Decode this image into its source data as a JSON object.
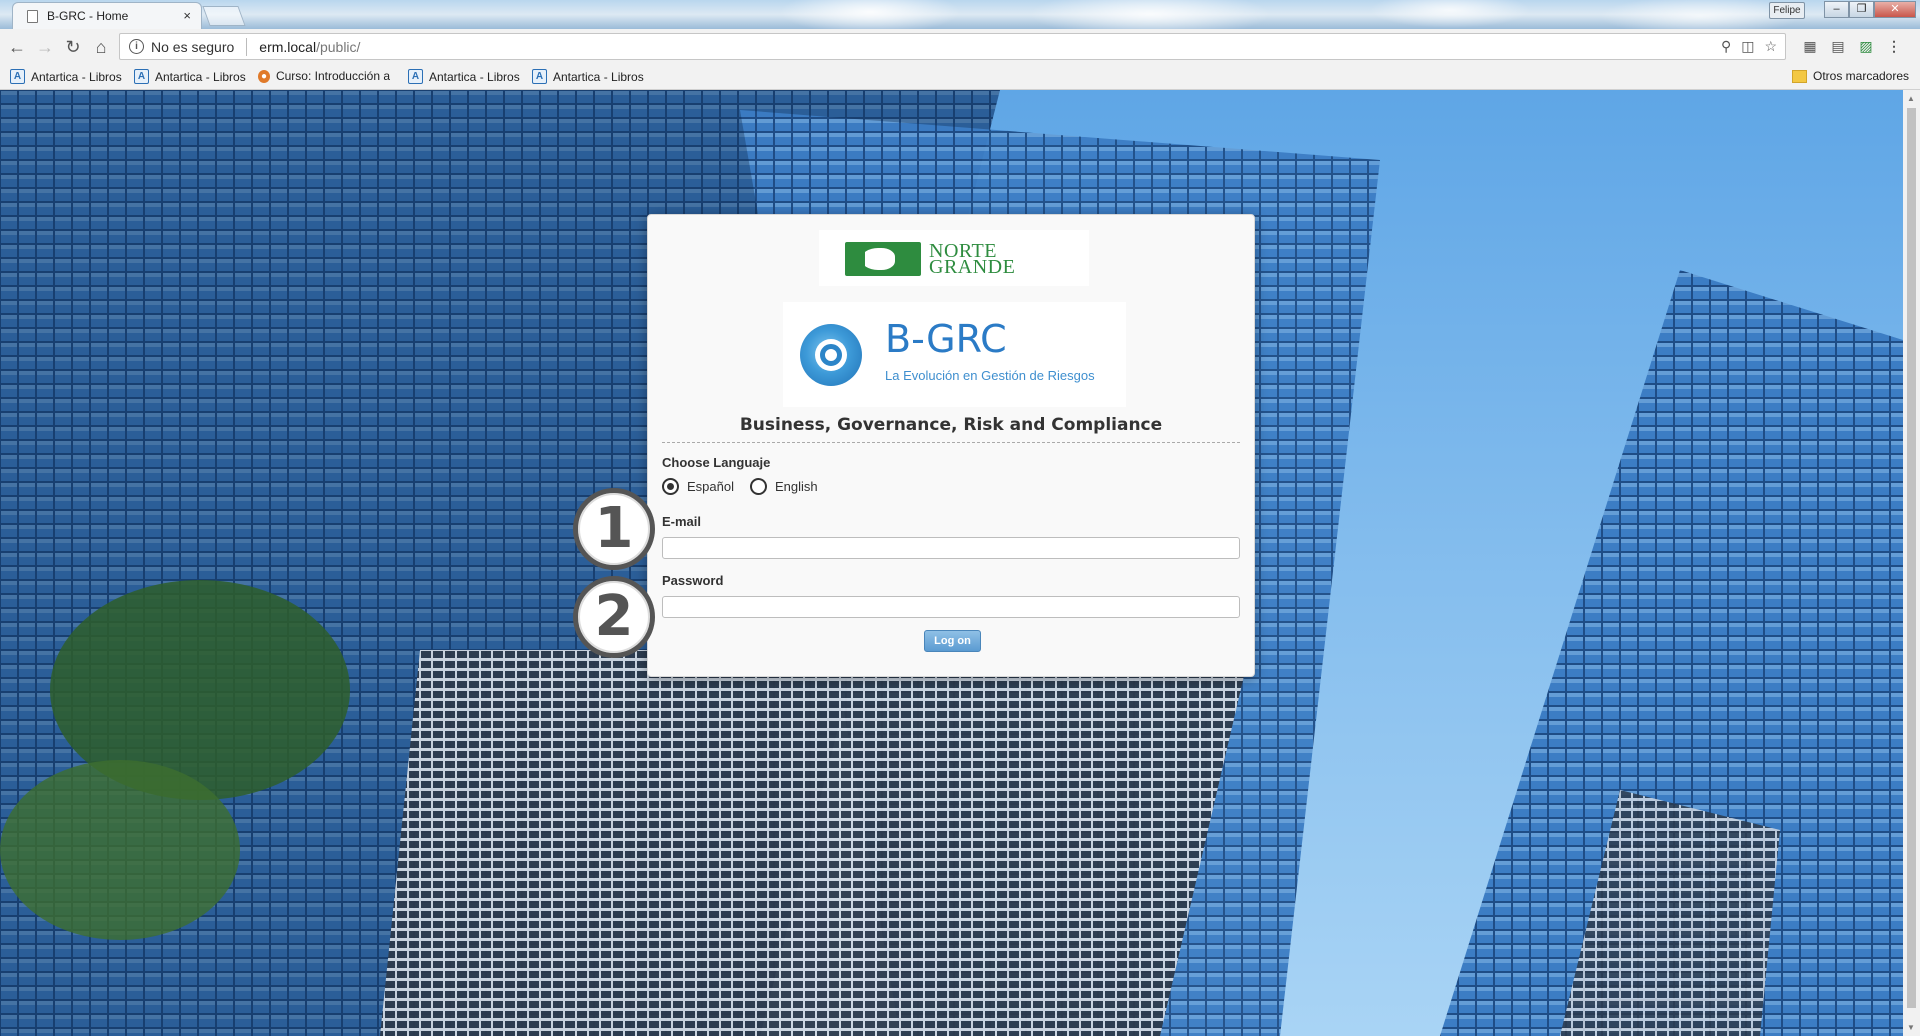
{
  "browser": {
    "tab_title": "B-GRC - Home",
    "tab_close": "×",
    "user_name": "Felipe",
    "security_text": "No es seguro",
    "url_host": "erm.local",
    "url_path": "/public/",
    "bookmarks": [
      {
        "label": "Antartica - Libros",
        "icon": "antartica-icon"
      },
      {
        "label": "Antartica - Libros",
        "icon": "antartica-icon"
      },
      {
        "label": "Curso: Introducción a",
        "icon": "course-icon"
      },
      {
        "label": "Antartica - Libros",
        "icon": "antartica-icon"
      },
      {
        "label": "Antartica - Libros",
        "icon": "antartica-icon"
      }
    ],
    "other_bookmarks": "Otros marcadores"
  },
  "login": {
    "brand_ng_line1": "NORTE",
    "brand_ng_line2": "GRANDE",
    "product_name": "B-GRC",
    "product_tagline": "La Evolución en Gestión de Riesgos",
    "heading": "Business, Governance, Risk and Compliance",
    "language_label": "Choose Languaje",
    "language_options": [
      "Español",
      "English"
    ],
    "selected_language": "Español",
    "email_label": "E-mail",
    "email_value": "",
    "password_label": "Password",
    "password_value": "",
    "submit_label": "Log on"
  },
  "callouts": [
    "1",
    "2"
  ],
  "colors": {
    "brand_green": "#2e8c3f",
    "brand_blue": "#2b7bc6",
    "button_blue": "#5b9bd2"
  }
}
